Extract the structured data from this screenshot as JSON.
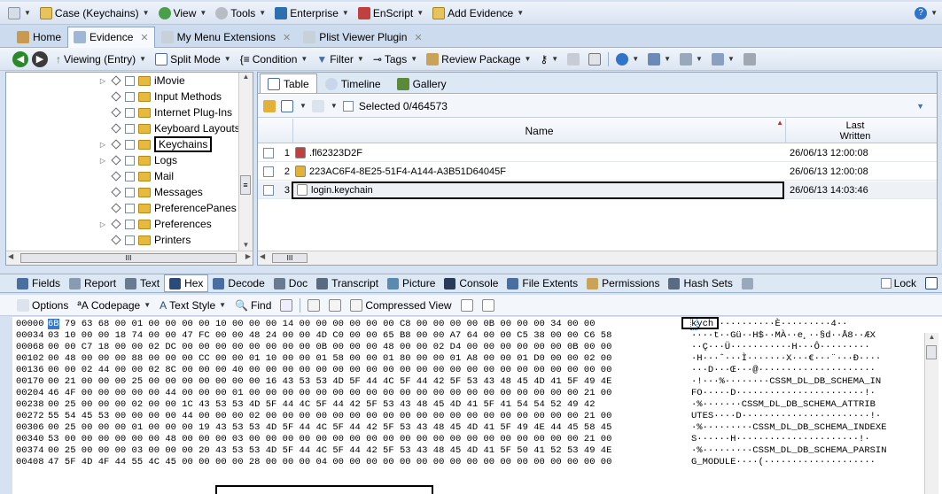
{
  "menubar": {
    "items": [
      {
        "label": "Case (Keychains)",
        "icon": "case-icon"
      },
      {
        "label": "View",
        "icon": "view-icon"
      },
      {
        "label": "Tools",
        "icon": "tools-icon"
      },
      {
        "label": "Enterprise",
        "icon": "enterprise-icon"
      },
      {
        "label": "EnScript",
        "icon": "enscript-icon"
      },
      {
        "label": "Add Evidence",
        "icon": "add-evidence-icon"
      }
    ],
    "help_icon": "help-icon"
  },
  "tabs": [
    {
      "label": "Home"
    },
    {
      "label": "Evidence"
    },
    {
      "label": "My Menu Extensions"
    },
    {
      "label": "Plist Viewer Plugin"
    }
  ],
  "navbar": {
    "viewing": "Viewing (Entry)",
    "split_mode": "Split Mode",
    "condition": "Condition",
    "filter": "Filter",
    "tags": "Tags",
    "review_package": "Review Package"
  },
  "tree": {
    "items": [
      {
        "label": "iMovie"
      },
      {
        "label": "Input Methods"
      },
      {
        "label": "Internet Plug-Ins"
      },
      {
        "label": "Keyboard Layouts"
      },
      {
        "label": "Keychains"
      },
      {
        "label": "Logs"
      },
      {
        "label": "Mail"
      },
      {
        "label": "Messages"
      },
      {
        "label": "PreferencePanes"
      },
      {
        "label": "Preferences"
      },
      {
        "label": "Printers"
      }
    ]
  },
  "viewtabs": [
    {
      "label": "Table"
    },
    {
      "label": "Timeline"
    },
    {
      "label": "Gallery"
    }
  ],
  "table": {
    "selected": "Selected 0/464573",
    "columns": {
      "name": "Name",
      "last_written_1": "Last",
      "last_written_2": "Written"
    },
    "rows": [
      {
        "num": "1",
        "name": ".fl62323D2F",
        "date": "26/06/13 12:00:08"
      },
      {
        "num": "2",
        "name": "223AC6F4-8E25-51F4-A144-A3B51D64045F",
        "date": "26/06/13 12:00:08"
      },
      {
        "num": "3",
        "name": "login.keychain",
        "date": "26/06/13 14:03:46"
      }
    ]
  },
  "bottom_tabs": [
    {
      "label": "Fields"
    },
    {
      "label": "Report"
    },
    {
      "label": "Text"
    },
    {
      "label": "Hex"
    },
    {
      "label": "Decode"
    },
    {
      "label": "Doc"
    },
    {
      "label": "Transcript"
    },
    {
      "label": "Picture"
    },
    {
      "label": "Console"
    },
    {
      "label": "File Extents"
    },
    {
      "label": "Permissions"
    },
    {
      "label": "Hash Sets"
    }
  ],
  "lock_label": "Lock",
  "hextools": {
    "options": "Options",
    "codepage": "Codepage",
    "text_style": "Text Style",
    "find": "Find",
    "compressed_view": "Compressed View"
  },
  "hex": {
    "rows": [
      {
        "off": "00000",
        "first": "6B",
        "bytes": " 79 63 68 00 01 00 00 00 00 10 00 00 00 14 00 00 00 00 00 00 C8 00 00 00 00 0B 00 00 00 34 00 00",
        "ascii_sel": "k",
        "ascii": "ych ··········È·········4··"
      },
      {
        "off": "00034",
        "first": "",
        "bytes": "03 10 00 00 18 74 00 00 47 FC 00 00 48 24 00 00 4D C0 00 00 65 B8 00 00 A7 64 00 00 C5 38 00 00 C6 58",
        "ascii_sel": "",
        "ascii": "····t··Gü··H$··MÀ··e¸··§d··Å8··ÆX"
      },
      {
        "off": "00068",
        "first": "",
        "bytes": "00 00 C7 18 00 00 02 DC 00 00 00 00 00 00 00 00 0B 00 00 00 48 00 00 02 D4 00 00 00 00 00 00 0B 00 00",
        "ascii_sel": "",
        "ascii": "··Ç···Ü···········H···Ô·········"
      },
      {
        "off": "00102",
        "first": "",
        "bytes": "00 48 00 00 00 88 00 00 00 CC 00 00 01 10 00 00 01 58 00 00 01 80 00 00 01 A8 00 00 01 D0 00 00 02 00",
        "ascii_sel": "",
        "ascii": "·H···ˆ···Ì·······X···€···¨···Ð····"
      },
      {
        "off": "00136",
        "first": "",
        "bytes": "00 00 02 44 00 00 02 8C 00 00 00 40 00 00 00 00 00 00 00 00 00 00 00 00 00 00 00 00 00 00 00 00 00 00",
        "ascii_sel": "",
        "ascii": "···D···Œ···@·····················"
      },
      {
        "off": "00170",
        "first": "",
        "bytes": "00 21 00 00 00 25 00 00 00 00 00 00 00 16 43 53 53 4D 5F 44 4C 5F 44 42 5F 53 43 48 45 4D 41 5F 49 4E",
        "ascii_sel": "",
        "ascii": "·!···%········CSSM_DL_DB_SCHEMA_IN"
      },
      {
        "off": "00204",
        "first": "",
        "bytes": "46 4F 00 00 00 00 00 44 00 00 00 01 00 00 00 00 00 00 00 00 00 00 00 00 00 00 00 00 00 00 00 00 21 00",
        "ascii_sel": "",
        "ascii": "FO·····D·······················!·"
      },
      {
        "off": "00238",
        "first": "",
        "bytes": "00 25 00 00 00 02 00 00 1C 43 53 53 4D 5F 44 4C 5F 44 42 5F 53 43 48 45 4D 41 5F 41 54 54 52 49 42",
        "ascii_sel": "",
        "ascii": "·%·······CSSM_DL_DB_SCHEMA_ATTRIB"
      },
      {
        "off": "00272",
        "first": "",
        "bytes": "55 54 45 53 00 00 00 00 44 00 00 00 02 00 00 00 00 00 00 00 00 00 00 00 00 00 00 00 00 00 00 00 21 00",
        "ascii_sel": "",
        "ascii": "UTES····D·······················!·"
      },
      {
        "off": "00306",
        "first": "",
        "bytes": "00 25 00 00 00 01 00 00 00 19 43 53 53 4D 5F 44 4C 5F 44 42 5F 53 43 48 45 4D 41 5F 49 4E 44 45 58 45",
        "ascii_sel": "",
        "ascii": "·%·········CSSM_DL_DB_SCHEMA_INDEXE"
      },
      {
        "off": "00340",
        "first": "",
        "bytes": "53 00 00 00 00 00 00 48 00 00 00 03 00 00 00 00 00 00 00 00 00 00 00 00 00 00 00 00 00 00 00 00 21 00",
        "ascii_sel": "",
        "ascii": "S······H······················!·"
      },
      {
        "off": "00374",
        "first": "",
        "bytes": "00 25 00 00 00 03 00 00 00 20 43 53 53 4D 5F 44 4C 5F 44 42 5F 53 43 48 45 4D 41 5F 50 41 52 53 49 4E",
        "ascii_sel": "",
        "ascii": "·%·········CSSM_DL_DB_SCHEMA_PARSIN"
      },
      {
        "off": "00408",
        "first": "",
        "bytes": "47 5F 4D 4F 44 55 4C 45 00 00 00 00 28 00 00 00 04 00 00 00 00 00 00 00 00 00 00 00 00 00 00 00 00 00",
        "ascii_sel": "",
        "ascii": "G_MODULE····(····················"
      }
    ]
  }
}
